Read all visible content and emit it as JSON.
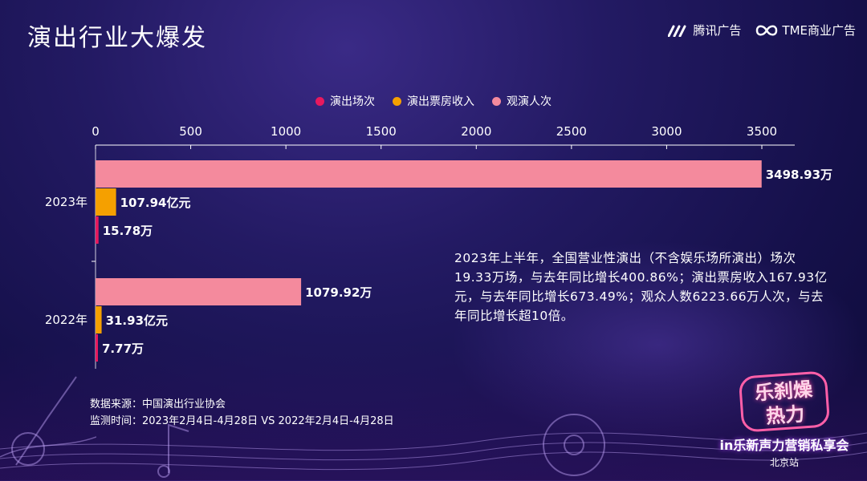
{
  "header": {
    "title": "演出行业大爆发",
    "logos": [
      "腾讯广告",
      "TME商业广告"
    ]
  },
  "chart_data": {
    "type": "bar",
    "orientation": "horizontal",
    "categories": [
      "2023年",
      "2022年"
    ],
    "xlim": [
      0,
      3500
    ],
    "x_ticks": [
      "0",
      "500",
      "1000",
      "1500",
      "2000",
      "2500",
      "3000",
      "3500"
    ],
    "x_tick_values": [
      0,
      500,
      1000,
      1500,
      2000,
      2500,
      3000,
      3500
    ],
    "legend_position": "top",
    "series": [
      {
        "name": "演出场次",
        "color": "#e8195e",
        "values": [
          15.78,
          7.77
        ],
        "labels": [
          "15.78万",
          "7.77万"
        ]
      },
      {
        "name": "演出票房收入",
        "color": "#f5a000",
        "values": [
          107.94,
          31.93
        ],
        "labels": [
          "107.94亿元",
          "31.93亿元"
        ]
      },
      {
        "name": "观演人次",
        "color": "#f48a9d",
        "values": [
          3498.93,
          1079.92
        ],
        "labels": [
          "3498.93万",
          "1079.92万"
        ]
      }
    ]
  },
  "description": "2023年上半年，全国营业性演出（不含娱乐场所演出）场次19.33万场，与去年同比增长400.86%；演出票房收入167.93亿元，与去年同比增长673.49%；观众人数6223.66万人次，与去年同比增长超10倍。",
  "source": {
    "line1": "数据来源：中国演出行业协会",
    "line2": "监测时间：2023年2月4日-4月28日 VS 2022年2月4日-4月28日"
  },
  "badge": {
    "logo_text": "乐刹燥 热力",
    "line1": "in乐新声力营销私享会",
    "line2": "北京站"
  }
}
